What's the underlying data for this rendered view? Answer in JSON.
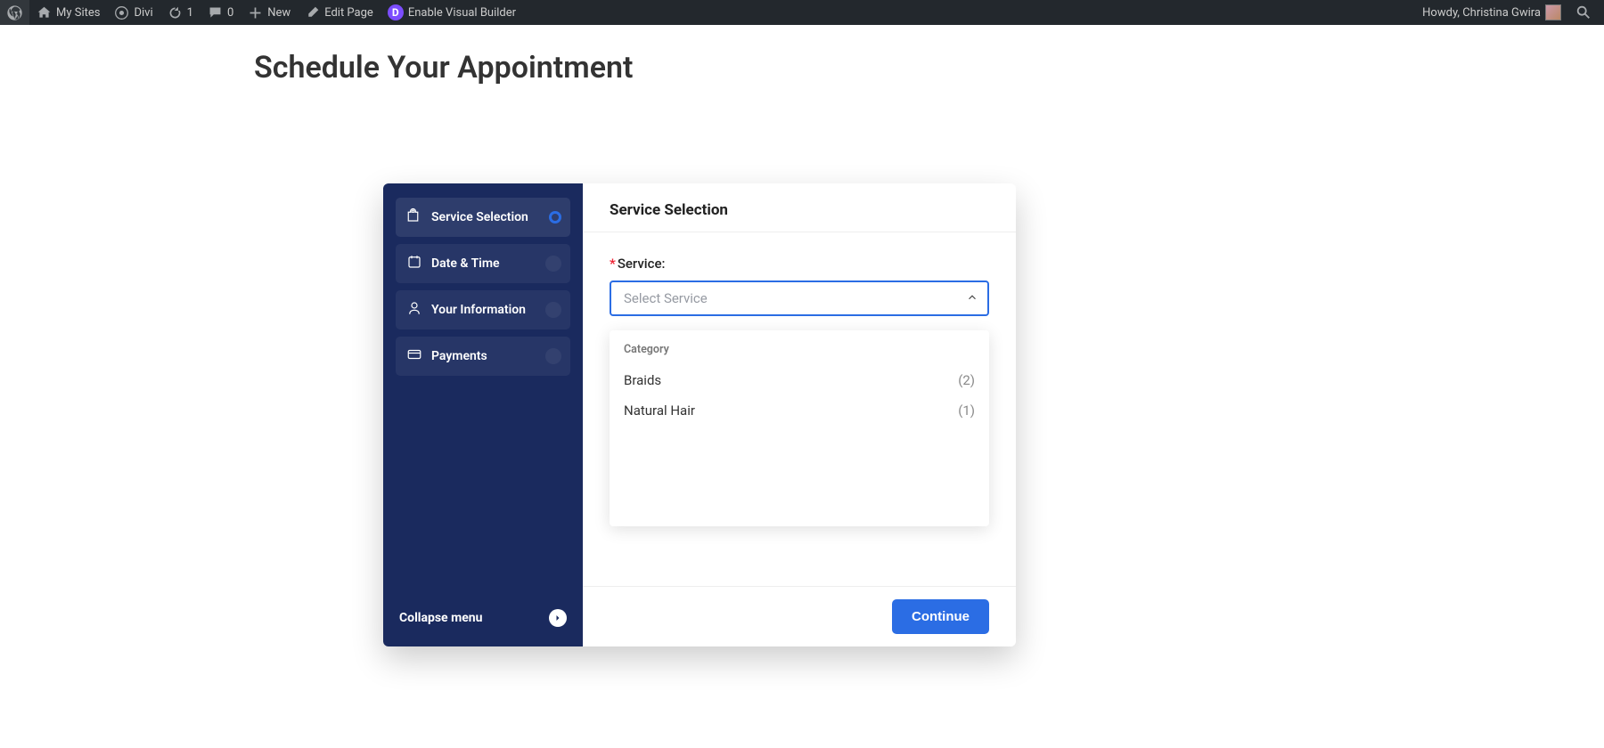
{
  "wpbar": {
    "mysites": "My Sites",
    "divi": "Divi",
    "updates": "1",
    "comments": "0",
    "neu": "New",
    "edit": "Edit Page",
    "vb": "Enable Visual Builder",
    "howdy": "Howdy, Christina Gwira"
  },
  "page": {
    "title": "Schedule Your Appointment"
  },
  "sidebar": {
    "steps": [
      {
        "label": "Service Selection"
      },
      {
        "label": "Date & Time"
      },
      {
        "label": "Your Information"
      },
      {
        "label": "Payments"
      }
    ],
    "collapse": "Collapse menu"
  },
  "panel": {
    "heading": "Service Selection",
    "field_label": "Service:",
    "placeholder": "Select Service",
    "category_header": "Category",
    "options": [
      {
        "name": "Braids",
        "count": "(2)"
      },
      {
        "name": "Natural Hair",
        "count": "(1)"
      }
    ],
    "continue": "Continue"
  }
}
